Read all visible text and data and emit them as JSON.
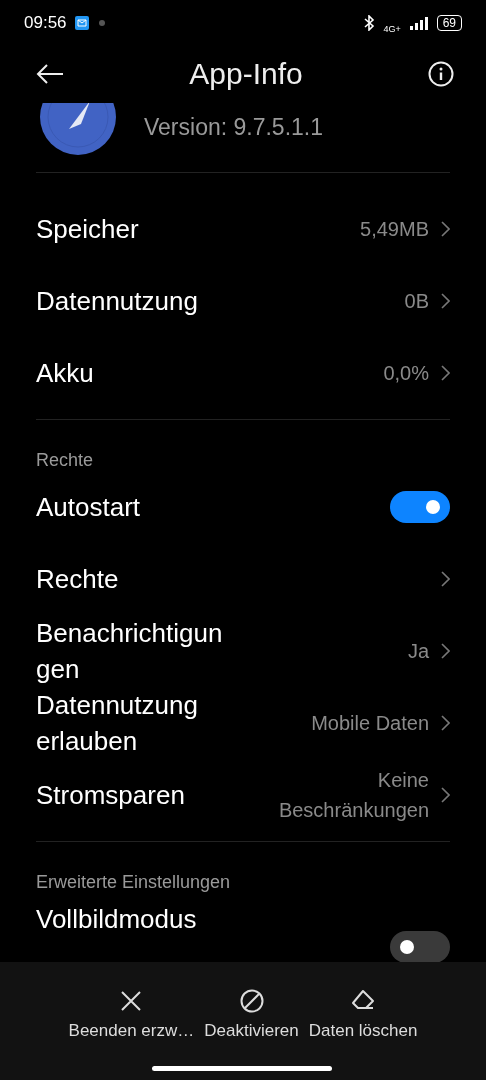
{
  "status_bar": {
    "time": "09:56",
    "network": "4G+",
    "battery": "69"
  },
  "header": {
    "title": "App-Info"
  },
  "app": {
    "version": "Version: 9.7.5.1.1"
  },
  "sections": [
    {
      "rows": [
        {
          "kind": "nav",
          "label": "Speicher",
          "value": "5,49MB"
        },
        {
          "kind": "nav",
          "label": "Datennutzung",
          "value": "0B"
        },
        {
          "kind": "nav",
          "label": "Akku",
          "value": "0,0%"
        }
      ]
    },
    {
      "title": "Rechte",
      "rows": [
        {
          "kind": "toggle",
          "label": "Autostart",
          "on": true
        },
        {
          "kind": "nav",
          "label": "Rechte"
        },
        {
          "kind": "nav",
          "label": "Benachrichtigungen",
          "value": "Ja"
        },
        {
          "kind": "nav",
          "label": "Datennutzung erlauben",
          "value": "Mobile Daten"
        },
        {
          "kind": "nav",
          "label": "Stromsparen",
          "value": "Keine Beschränkungen"
        }
      ]
    },
    {
      "title": "Erweiterte Einstellungen",
      "rows": [
        {
          "kind": "toggle",
          "label": "Vollbildmodus",
          "on": false
        }
      ]
    }
  ],
  "actions": [
    {
      "kind": "close",
      "label": "Beenden erzw…"
    },
    {
      "kind": "block",
      "label": "Deaktivieren"
    },
    {
      "kind": "eraser",
      "label": "Daten löschen"
    }
  ]
}
